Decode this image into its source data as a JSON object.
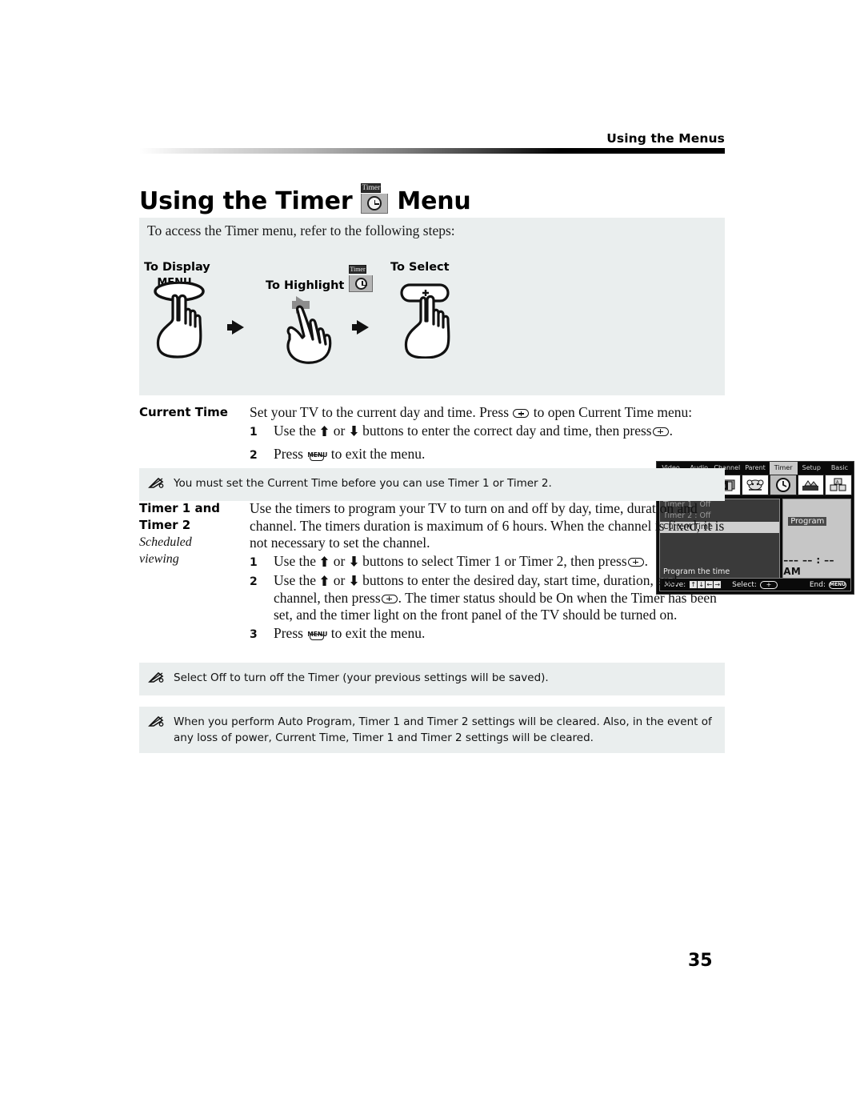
{
  "header": {
    "running_head": "Using the Menus"
  },
  "title": {
    "before": "Using the Timer",
    "after": "Menu",
    "icon_label": "Timer"
  },
  "steps_panel": {
    "intro": "To access the Timer menu, refer to the following steps:",
    "step1_label": "To Display",
    "step1_button": "MENU",
    "step2_label": "To Highlight",
    "step2_icon_label": "Timer",
    "step3_label": "To Select"
  },
  "tv": {
    "tabs": [
      {
        "label": "Video",
        "active": false
      },
      {
        "label": "Audio",
        "active": false
      },
      {
        "label": "Channel",
        "active": false
      },
      {
        "label": "Parent",
        "active": false
      },
      {
        "label": "Timer",
        "active": true
      },
      {
        "label": "Setup",
        "active": false
      },
      {
        "label": "Basic",
        "active": false
      }
    ],
    "menu_items": [
      {
        "label": "Timer 1 : Off",
        "selected": false
      },
      {
        "label": "Timer 2 : Off",
        "selected": false
      },
      {
        "label": "Current Time",
        "selected": true
      }
    ],
    "hint": "Program the time",
    "program_label": "Program",
    "time_value": "––– –– : ––AM",
    "footer": {
      "move_label": "Move:",
      "key_up": "↑",
      "key_down": "↓",
      "key_left": "←",
      "key_right": "→",
      "select_label": "Select:",
      "select_key": "+",
      "end_label": "End:",
      "end_key": "MENU"
    }
  },
  "current_time": {
    "term": "Current Time",
    "intro_a": "Set your TV to the current day and time. Press",
    "intro_b": "to open Current Time menu:",
    "steps": [
      {
        "num": "1",
        "a": "Use the",
        "b": "or",
        "c": "buttons to enter the correct day and time, then press",
        "d": "."
      },
      {
        "num": "2",
        "a": "Press",
        "b": "to exit the menu."
      }
    ]
  },
  "note1": {
    "text": "You must set the Current Time before you can use Timer 1 or Timer 2."
  },
  "timers": {
    "term_line1": "Timer 1 and",
    "term_line2": "Timer 2",
    "sub_line1": "Scheduled",
    "sub_line2": "viewing",
    "para": "Use the timers to program your TV to turn on and off by day, time, duration and channel. The timers duration is maximum of 6 hours. When the channel is fixed, it is not necessary to set the channel.",
    "steps": [
      {
        "num": "1",
        "a": "Use the",
        "b": "or",
        "c": "buttons to select Timer 1 or Timer 2, then press",
        "d": "."
      },
      {
        "num": "2",
        "a": "Use the",
        "b": "or",
        "c": "buttons to enter the desired day, start time, duration, and channel, then press",
        "d": ". The timer status should be On when the Timer has been set, and the timer light on the front panel of the TV should be turned on."
      },
      {
        "num": "3",
        "a": "Press",
        "b": "to exit the menu."
      }
    ]
  },
  "note2": {
    "text": "Select Off to turn off the Timer (your previous settings will be saved)."
  },
  "note3": {
    "text": "When you perform Auto Program, Timer 1 and Timer 2 settings will be cleared. Also, in the event of any loss of power, Current Time, Timer 1 and Timer 2 settings will be cleared."
  },
  "page_number": "35"
}
